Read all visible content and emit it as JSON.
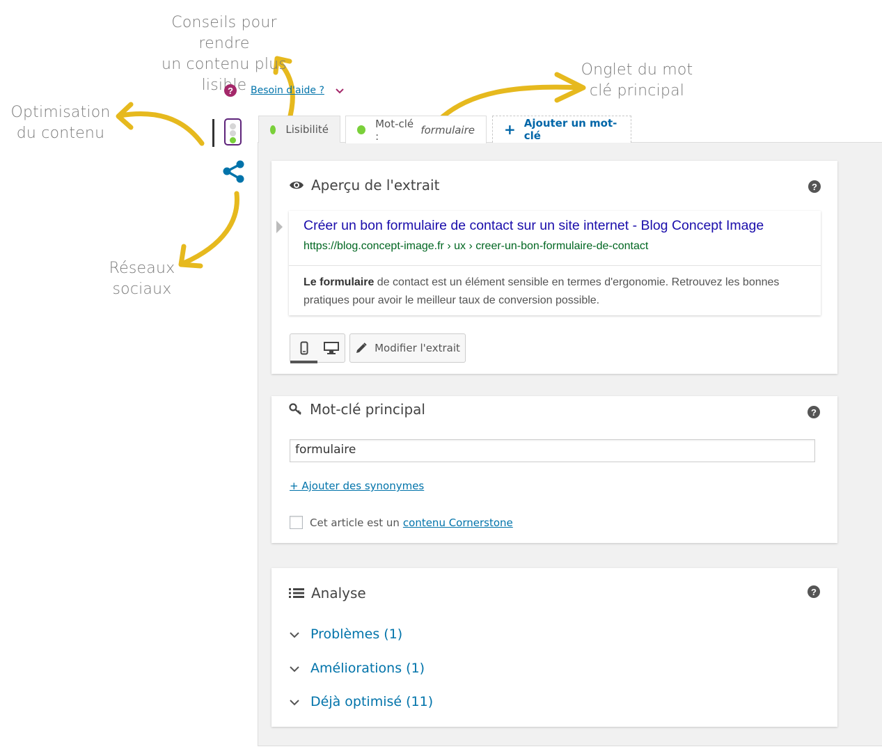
{
  "annotations": {
    "readability_tips": "Conseils pour rendre\nun contenu plus\nlisible",
    "content_optimization": "Optimisation\ndu contenu",
    "main_keyword_tab": "Onglet du mot\nclé principal",
    "social_networks": "Réseaux\nsociaux"
  },
  "help": {
    "icon": "question-mark-icon",
    "link_label": "Besoin d'aide ?",
    "chevron": "chevron-down-icon"
  },
  "sidebar": {
    "icons": [
      "traffic-light-icon",
      "share-icon"
    ]
  },
  "tabs": [
    {
      "label": "Lisibilité",
      "status_color": "#7ad03a"
    },
    {
      "label": "Mot-clé :",
      "keyword": "formulaire",
      "status_color": "#7ad03a"
    },
    {
      "label": "Ajouter un mot-clé",
      "icon": "plus-icon"
    }
  ],
  "snippet": {
    "title": "Aperçu de l'extrait",
    "icon": "eye-icon",
    "search_title": "Créer un bon formulaire de contact sur un site internet - Blog Concept Image",
    "url": "https://blog.concept-image.fr › ux › creer-un-bon-formulaire-de-contact",
    "description_bold": "Le formulaire",
    "description_rest": " de contact est un élément sensible en termes d'ergonomie. Retrouvez les bonnes pratiques pour avoir le meilleur taux de conversion possible.",
    "mode_selected": "mobile",
    "edit_label": "Modifier l'extrait"
  },
  "keyword_card": {
    "title": "Mot-clé principal",
    "icon": "key-icon",
    "input_value": "formulaire",
    "synonyms_link": "+ Ajouter des synonymes",
    "cornerstone_text": "Cet article est un",
    "cornerstone_link": "contenu Cornerstone",
    "cornerstone_checked": false
  },
  "analysis": {
    "title": "Analyse",
    "icon": "list-icon",
    "items": [
      {
        "label": "Problèmes (1)"
      },
      {
        "label": "Améliorations (1)"
      },
      {
        "label": "Déjà optimisé (11)"
      }
    ]
  },
  "colors": {
    "arrow": "#e6b91e",
    "brand_purple": "#a4286a",
    "link_blue": "#0073aa",
    "status_green": "#7ad03a"
  }
}
